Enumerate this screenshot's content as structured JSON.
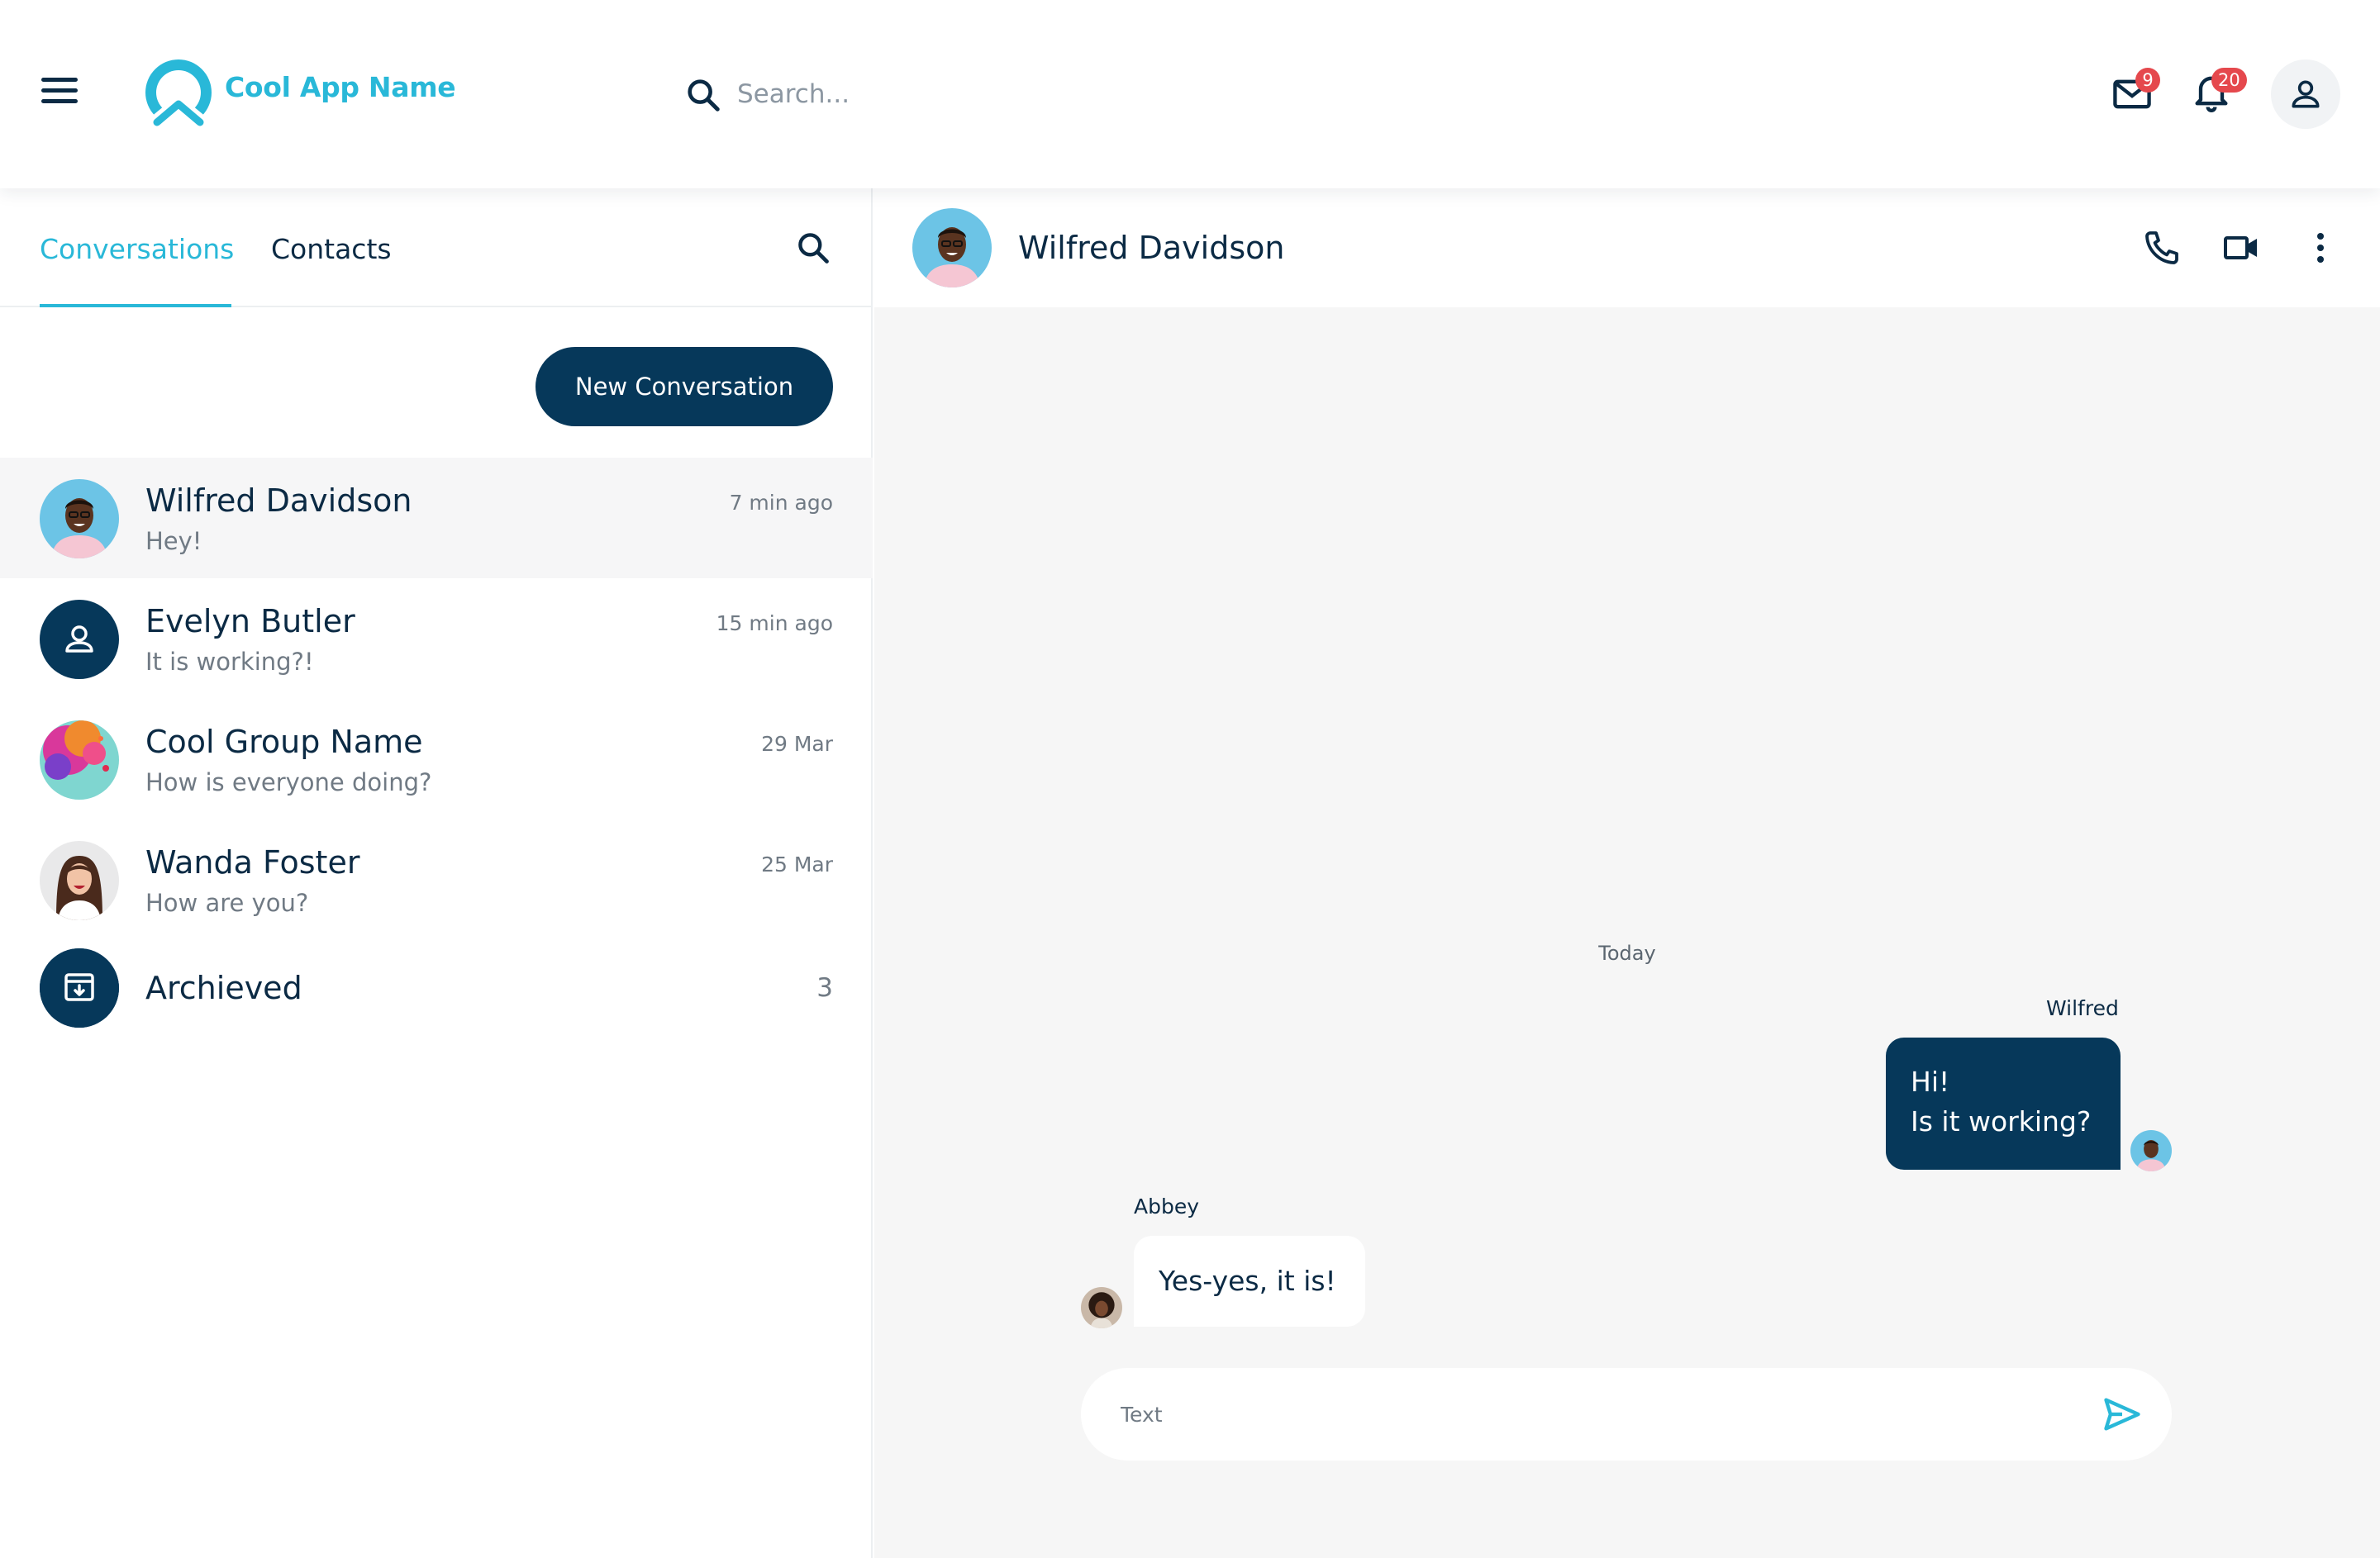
{
  "header": {
    "app_name": "Cool App Name",
    "search_placeholder": "Search...",
    "mail_badge": "9",
    "notification_badge": "20",
    "icons": [
      "menu-icon",
      "logo-icon",
      "search-icon",
      "mail-icon",
      "bell-icon",
      "user-icon"
    ]
  },
  "sidebar": {
    "tabs": [
      {
        "label": "Conversations",
        "active": true
      },
      {
        "label": "Contacts",
        "active": false
      }
    ],
    "new_conversation_label": "New Conversation",
    "conversations": [
      {
        "name": "Wilfred Davidson",
        "last_message": "Hey!",
        "time": "7 min ago",
        "selected": true
      },
      {
        "name": "Evelyn Butler",
        "last_message": "It is working?!",
        "time": "15 min ago",
        "selected": false
      },
      {
        "name": "Cool Group Name",
        "last_message": "How is everyone doing?",
        "time": "29 Mar",
        "selected": false
      },
      {
        "name": "Wanda Foster",
        "last_message": "How are you?",
        "time": "25 Mar",
        "selected": false
      }
    ],
    "archived": {
      "label": "Archieved",
      "count": "3"
    }
  },
  "chat": {
    "contact_name": "Wilfred Davidson",
    "day_label": "Today",
    "messages": [
      {
        "sender": "Wilfred",
        "lines": [
          "Hi!",
          "Is it working?"
        ],
        "direction": "outgoing"
      },
      {
        "sender": "Abbey",
        "text": "Yes-yes, it is!",
        "direction": "incoming"
      }
    ],
    "composer_placeholder": "Text",
    "icons": [
      "phone-icon",
      "video-icon",
      "more-vertical-icon",
      "send-icon"
    ]
  },
  "colors": {
    "accent": "#29b8d8",
    "primary": "#06385a",
    "badge": "#e5484d",
    "text": "#0b2a44",
    "muted": "#707a84",
    "chat_background": "#f6f6f6"
  }
}
